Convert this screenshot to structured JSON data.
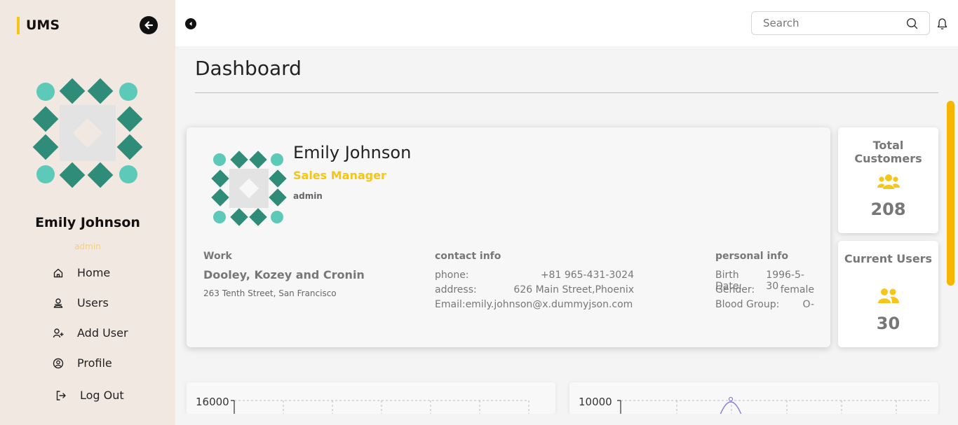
{
  "sidebar": {
    "brand": "UMS",
    "user_name": "Emily Johnson",
    "user_role": "admin",
    "nav": {
      "home": "Home",
      "users": "Users",
      "add_user": "Add User",
      "profile": "Profile",
      "logout": "Log Out"
    }
  },
  "topbar": {
    "search_placeholder": "Search"
  },
  "page": {
    "title": "Dashboard"
  },
  "profile": {
    "name": "Emily Johnson",
    "job_title": "Sales Manager",
    "role": "admin",
    "work": {
      "heading": "Work",
      "company": "Dooley, Kozey and Cronin",
      "address": "263 Tenth Street, San Francisco"
    },
    "contact": {
      "heading": "contact info",
      "phone_label": "phone:",
      "phone": "+81 965-431-3024",
      "address_label": "address:",
      "address": "626 Main Street,Phoenix",
      "email_label": "Email:",
      "email": "emily.johnson@x.dummyjson.com"
    },
    "personal": {
      "heading": "personal info",
      "birth_label": "Birth Date:",
      "birth": "1996-5-30",
      "gender_label": "Gender:",
      "gender": "female",
      "blood_label": "Blood Group:",
      "blood": "O-"
    }
  },
  "stats": {
    "total_customers": {
      "label": "Total Customers",
      "value": "208",
      "icon": "users-group-icon"
    },
    "current_users": {
      "label": "Current Users",
      "value": "30",
      "icon": "users-pair-icon"
    }
  },
  "colors": {
    "accent": "#f5c518",
    "sidebar_bg": "#f1e9e1",
    "avatar_teal": "#2f8c78",
    "avatar_light_teal": "#5dcab9",
    "scroll_thumb": "#f7b500"
  },
  "charts": {
    "left_top_tick": "16000",
    "right_top_tick": "10000"
  }
}
